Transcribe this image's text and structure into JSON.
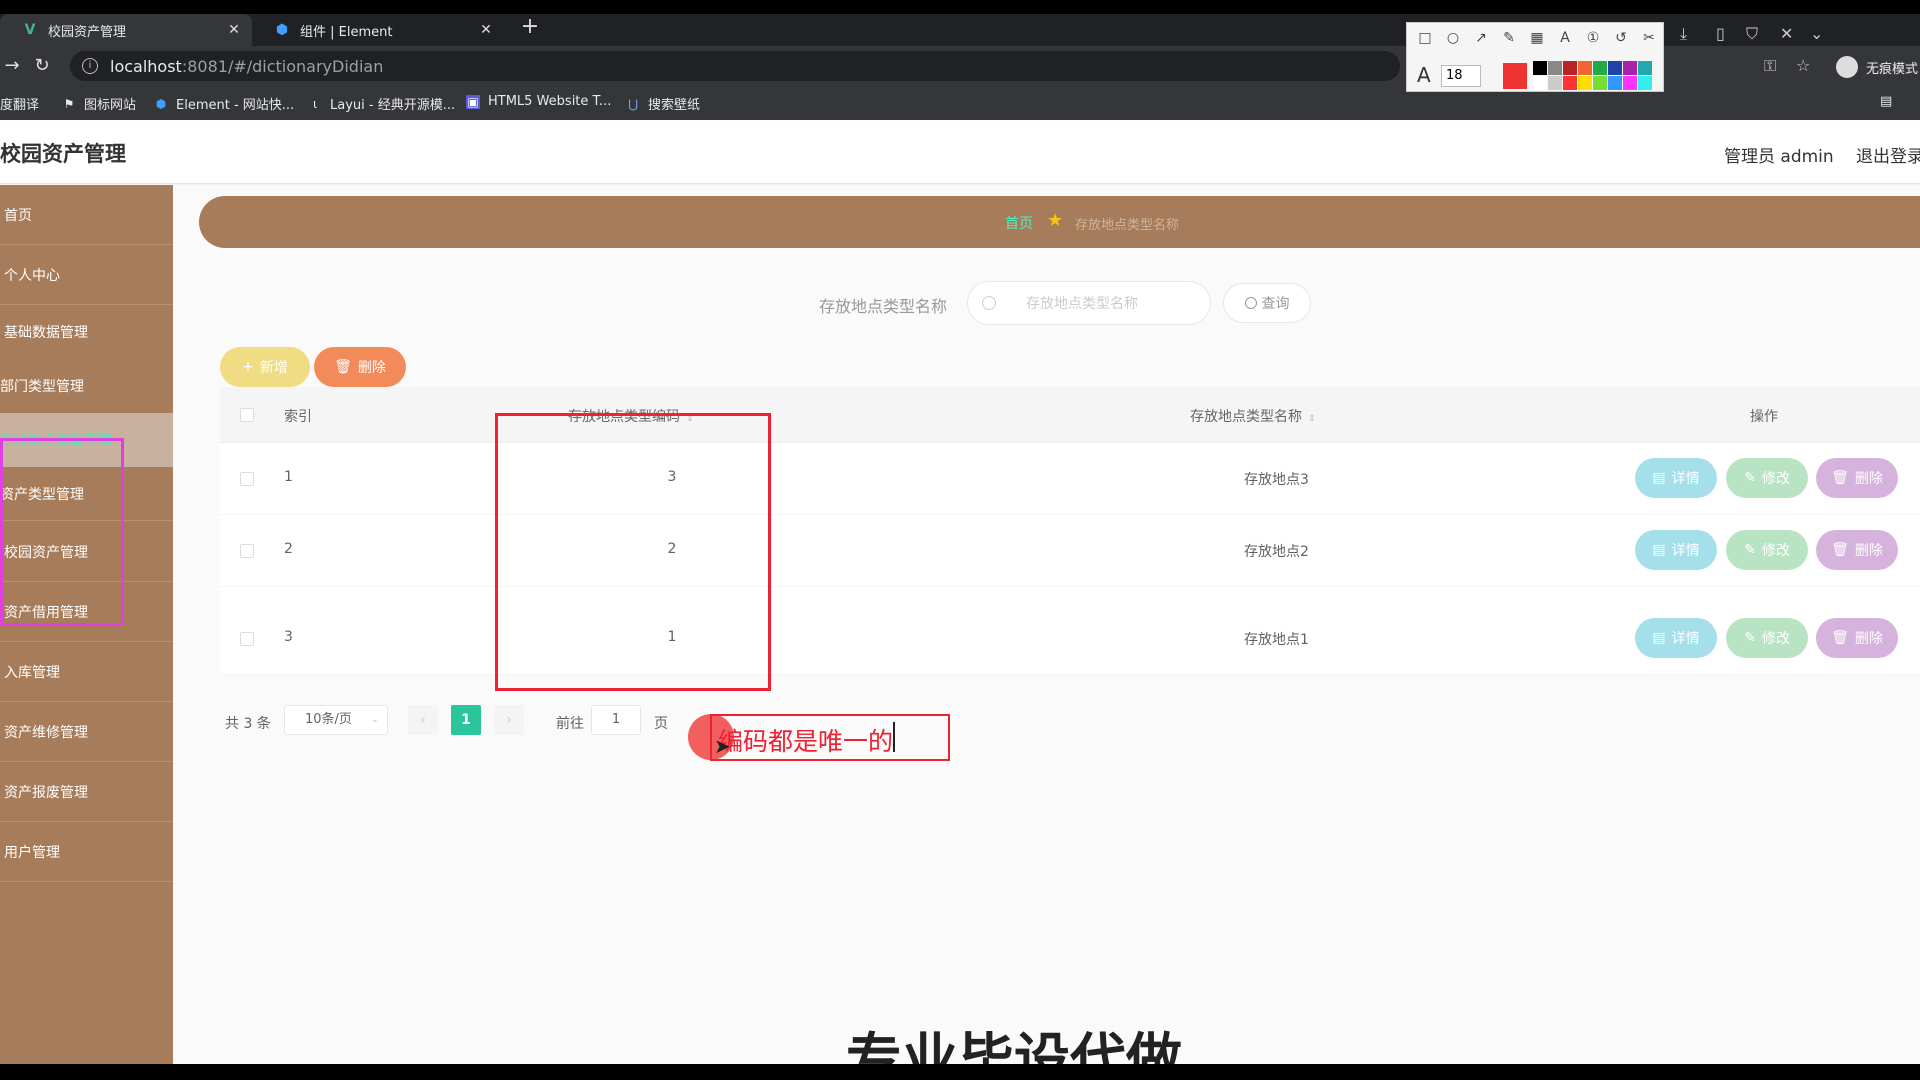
{
  "browser": {
    "tabs": [
      {
        "title": "校园资产管理",
        "icon": "vue-icon"
      },
      {
        "title": "组件 | Element",
        "icon": "element-icon"
      }
    ],
    "url_host": "localhost",
    "url_rest": ":8081/#/dictionaryDidian",
    "incognito_label": "无痕模式",
    "bookmarks": [
      {
        "label": "度翻译",
        "icon": "translate-icon"
      },
      {
        "label": "图标网站",
        "icon": "flag-icon"
      },
      {
        "label": "Element - 网站快...",
        "icon": "element-icon"
      },
      {
        "label": "Layui - 经典开源模...",
        "icon": "layui-icon"
      },
      {
        "label": "HTML5 Website T...",
        "icon": "html5-icon"
      },
      {
        "label": "搜索壁纸",
        "icon": "wallpaper-icon"
      }
    ]
  },
  "annotation_toolbar": {
    "font_size": "18",
    "selected_color": "#ee3333"
  },
  "header": {
    "title": "校园资产管理",
    "user": "管理员 admin",
    "logout": "退出登录"
  },
  "sidebar": {
    "items": [
      {
        "label": "首页"
      },
      {
        "label": "个人中心"
      },
      {
        "label": "基础数据管理"
      },
      {
        "label": "校园资产管理"
      },
      {
        "label": "资产借用管理"
      },
      {
        "label": "入库管理"
      },
      {
        "label": "资产维修管理"
      },
      {
        "label": "资产报废管理"
      },
      {
        "label": "用户管理"
      }
    ],
    "subitems": [
      {
        "label": "部门类型管理"
      },
      {
        "label": "存放地点类型管理"
      },
      {
        "label": "资产类型管理"
      }
    ]
  },
  "breadcrumb": {
    "home": "首页",
    "current": "存放地点类型名称"
  },
  "search": {
    "label": "存放地点类型名称",
    "placeholder": "存放地点类型名称",
    "query_button": "查询"
  },
  "actions": {
    "add": "新增",
    "delete": "删除"
  },
  "table": {
    "headers": {
      "index": "索引",
      "code": "存放地点类型编码",
      "name": "存放地点类型名称",
      "ops": "操作"
    },
    "rows": [
      {
        "index": "1",
        "code": "3",
        "name": "存放地点3"
      },
      {
        "index": "2",
        "code": "2",
        "name": "存放地点2"
      },
      {
        "index": "3",
        "code": "1",
        "name": "存放地点1"
      }
    ],
    "row_buttons": {
      "detail": "详情",
      "edit": "修改",
      "remove": "删除"
    }
  },
  "pagination": {
    "total": "共 3 条",
    "page_size": "10条/页",
    "current_page": "1",
    "goto_label": "前往",
    "goto_value": "1",
    "page_word": "页"
  },
  "annotation_note": "编码都是唯一的",
  "watermark": "专业毕设代做"
}
